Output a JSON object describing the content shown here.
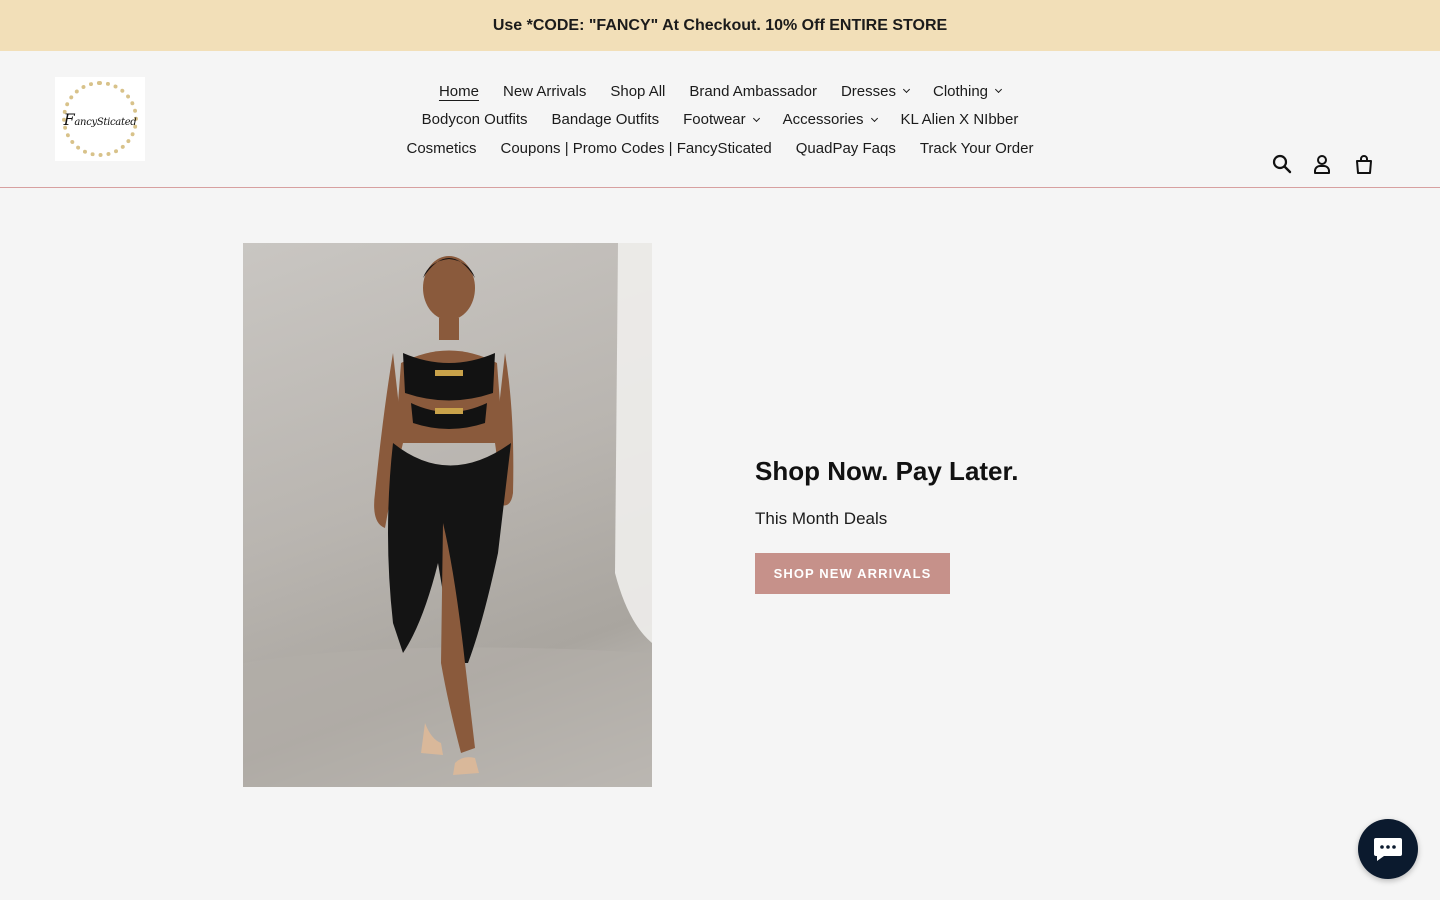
{
  "announcement": {
    "text": "Use *CODE: \"FANCY\" At Checkout. 10% Off ENTIRE STORE"
  },
  "logo": {
    "text_initial": "F",
    "text_rest": "ancySticated"
  },
  "nav": {
    "row1": [
      {
        "label": "Home",
        "active": true,
        "dropdown": false
      },
      {
        "label": "New Arrivals",
        "dropdown": false
      },
      {
        "label": "Shop All",
        "dropdown": false
      },
      {
        "label": "Brand Ambassador",
        "dropdown": false
      },
      {
        "label": "Dresses",
        "dropdown": true
      },
      {
        "label": "Clothing",
        "dropdown": true
      }
    ],
    "row2": [
      {
        "label": "Bodycon Outfits",
        "dropdown": false
      },
      {
        "label": "Bandage Outfits",
        "dropdown": false
      },
      {
        "label": "Footwear",
        "dropdown": true
      },
      {
        "label": "Accessories",
        "dropdown": true
      },
      {
        "label": "KL Alien X NIbber",
        "dropdown": false
      }
    ],
    "row3": [
      {
        "label": "Cosmetics",
        "dropdown": false
      },
      {
        "label": "Coupons | Promo Codes | FancySticated",
        "dropdown": false
      },
      {
        "label": "QuadPay Faqs",
        "dropdown": false
      },
      {
        "label": "Track Your Order",
        "dropdown": false
      }
    ]
  },
  "header_icons": [
    "search-icon",
    "account-icon",
    "cart-icon"
  ],
  "hero": {
    "title": "Shop Now. Pay Later.",
    "subtitle": "This Month Deals",
    "button_label": "SHOP NEW ARRIVALS"
  },
  "colors": {
    "announcement_bg": "#f2dfb8",
    "button_bg": "#c6918a",
    "header_border": "#d7a0a0",
    "chat_bg": "#0b1a2e"
  }
}
